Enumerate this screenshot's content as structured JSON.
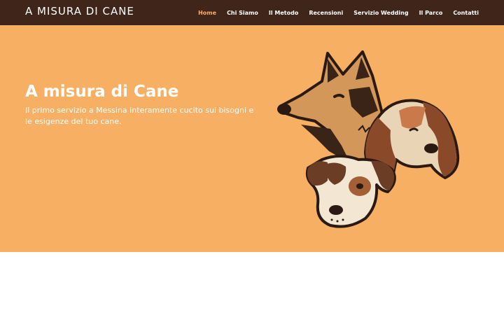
{
  "header": {
    "brand": "A MISURA DI CANE",
    "nav": [
      {
        "label": "Home",
        "active": true
      },
      {
        "label": "Chi Siamo",
        "active": false
      },
      {
        "label": "Il Metodo",
        "active": false
      },
      {
        "label": "Recensioni",
        "active": false
      },
      {
        "label": "Servizio Wedding",
        "active": false
      },
      {
        "label": "Il Parco",
        "active": false
      },
      {
        "label": "Contatti",
        "active": false
      }
    ]
  },
  "hero": {
    "title": "A misura di Cane",
    "subtitle": "Il primo servizio a Messina interamente cucito sui bisogni e le esigenze del tuo cane.",
    "illustration": "three-dogs-illustration"
  },
  "colors": {
    "nav_bg": "#40261a",
    "hero_bg": "#f7b063",
    "active_link": "#f7b063",
    "text": "#ffffff"
  }
}
